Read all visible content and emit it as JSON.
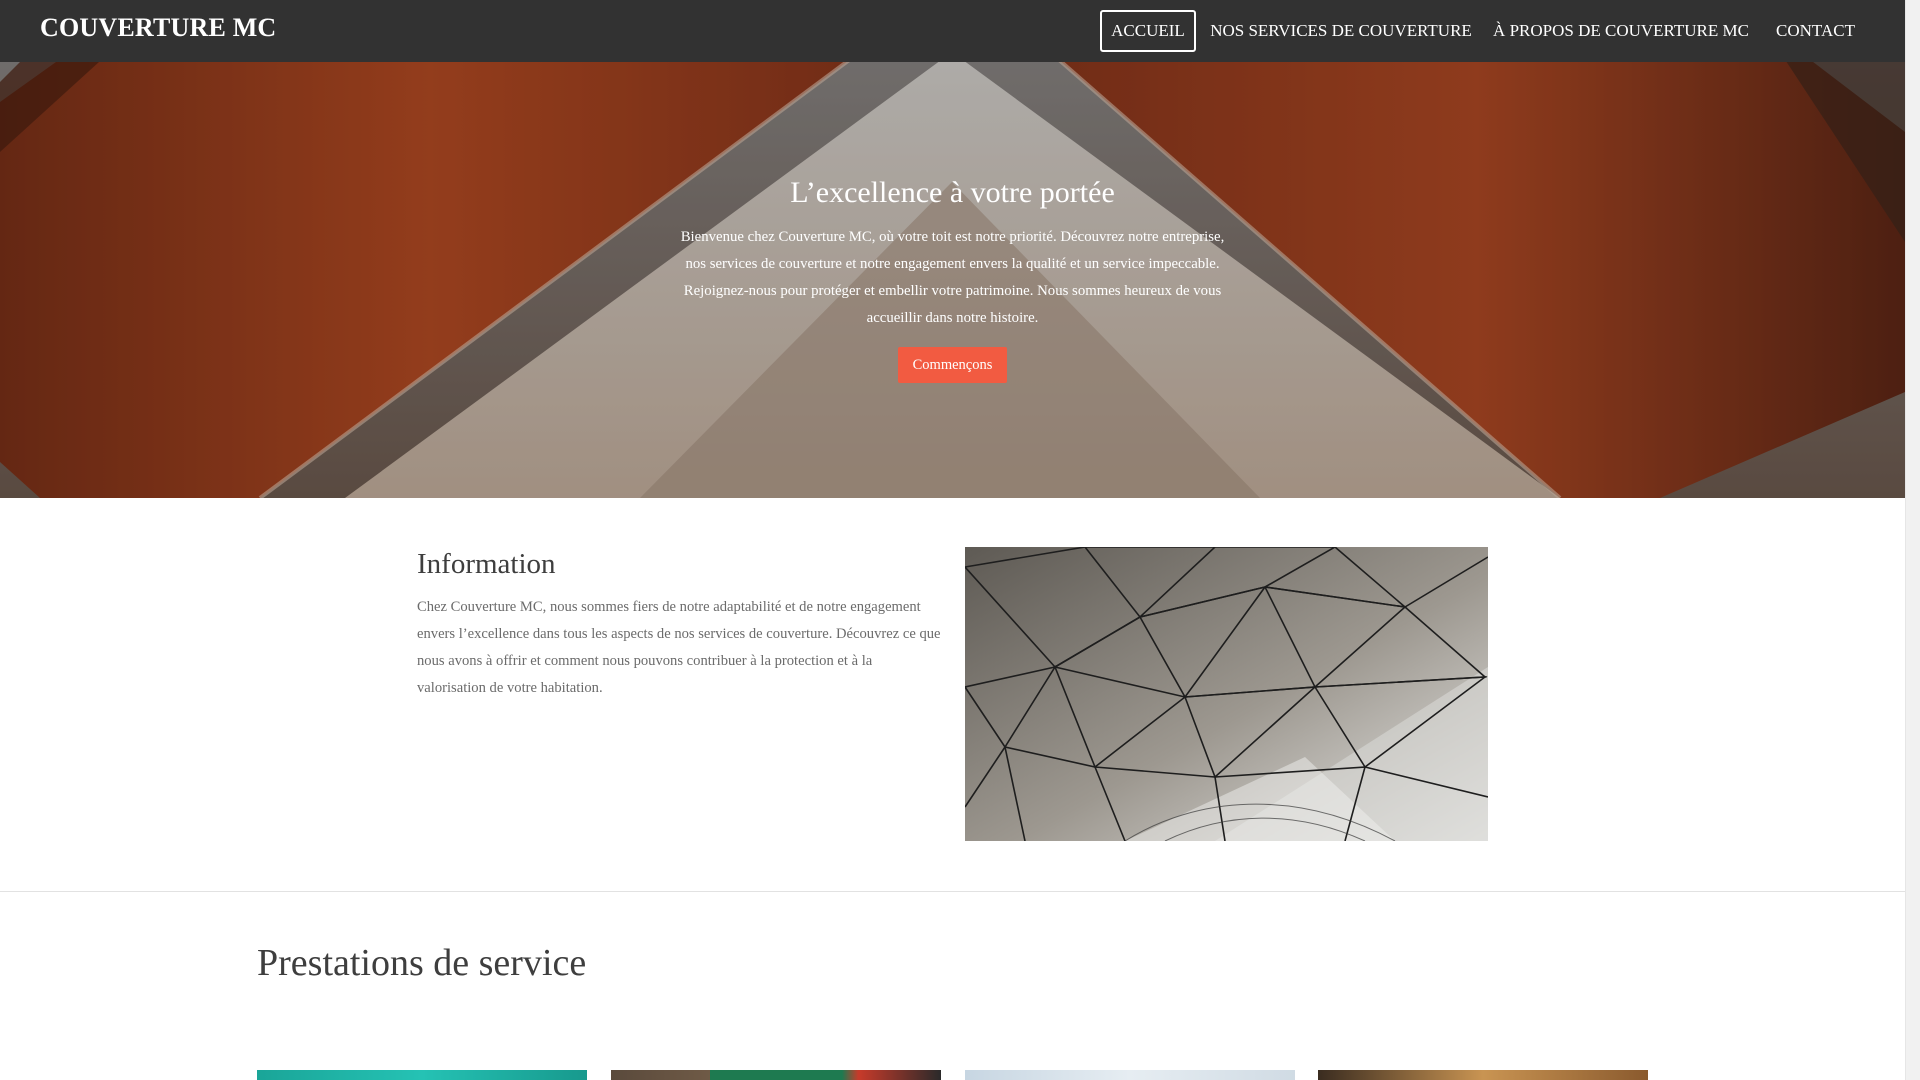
{
  "brand": "COUVERTURE MC",
  "nav": {
    "items": [
      {
        "label": "ACCUEIL",
        "active": true
      },
      {
        "label": "NOS SERVICES DE COUVERTURE",
        "active": false
      },
      {
        "label": "À PROPOS DE COUVERTURE MC",
        "active": false
      },
      {
        "label": "CONTACT",
        "active": false
      }
    ]
  },
  "hero": {
    "title": "L’excellence à votre portée",
    "text": "Bienvenue chez Couverture MC, où votre toit est notre priorité. Découvrez notre entreprise, nos services de couverture et notre engagement envers la qualité et un service impeccable. Rejoignez-nous pour protéger et embellir votre patrimoine. Nous sommes heureux de vous accueillir dans notre histoire.",
    "button_label": "Commençons"
  },
  "information": {
    "title": "Information",
    "text": "Chez Couverture MC, nous sommes fiers de notre adaptabilité et de notre engagement envers l’excellence dans tous les aspects de nos services de couverture. Découvrez ce que nous avons à offrir et comment nous pouvons contribuer à la protection et à la valorisation de votre habitation."
  },
  "services": {
    "title": "Prestations de service"
  },
  "colors": {
    "navbar": "#323232",
    "accent_button": "#f25b41",
    "heading_text": "#3e3e3e",
    "body_text": "#6b6b6b"
  }
}
